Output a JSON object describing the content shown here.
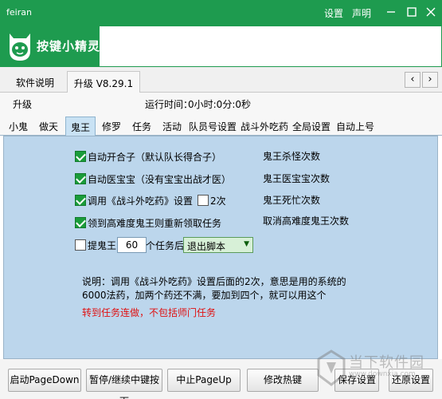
{
  "window": {
    "title": "feiran",
    "menu_settings": "设置",
    "menu_statement": "声明"
  },
  "brand": {
    "logo_text": "按键小精灵"
  },
  "top_tabs": [
    {
      "label": "软件说明"
    },
    {
      "label": "升级 V8.29.1"
    }
  ],
  "info": {
    "page_label": "升级",
    "runtime_label": "运行时间：",
    "runtime_value": "0小时:0分:0秒"
  },
  "script_tabs": [
    {
      "label": "小鬼"
    },
    {
      "label": "做天"
    },
    {
      "label": "鬼王"
    },
    {
      "label": "修罗"
    },
    {
      "label": "任务"
    },
    {
      "label": "活动"
    },
    {
      "label": "队员号设置"
    },
    {
      "label": "战斗外吃药"
    },
    {
      "label": "全局设置"
    },
    {
      "label": "自动上号"
    }
  ],
  "options": {
    "auto_combine": "自动开合子（默认队长得合子）",
    "auto_heal": "自动医宝宝（没有宝宝出战才医）",
    "use_medicine_pre": "调用《战斗外吃药》设置",
    "use_medicine_times": "2次",
    "hard_mode": "领到高难度鬼王则重新领取任务",
    "ghost_king_label": "提鬼王",
    "ghost_king_count": "60",
    "after_tasks_label": "个任务后",
    "after_tasks_action": "退出脚本"
  },
  "stats": {
    "kill": "鬼王杀怪次数",
    "heal": "鬼王医宝宝次数",
    "death": "鬼王死忙次数",
    "cancel": "取消高难度鬼王次数"
  },
  "note": {
    "text": "说明：调用《战斗外吃药》设置后面的2次，意思是用的系统的6000法药，加两个药还不满，要加到四个，就可以用这个",
    "red": "转到任务连做，不包括师门任务"
  },
  "buttons": {
    "start": "启动PageDown",
    "pause": "暂停/继续中键按下",
    "stop": "中止PageUp",
    "hotkey": "修改热键",
    "save": "保存设置",
    "restore": "还原设置"
  },
  "watermark": {
    "text": "当下软件园",
    "sub": "www.downxia.com"
  },
  "colors": {
    "titlebar": "#1e9b4f",
    "panel": "#bcd6ec",
    "checkbox": "#1a9c3a",
    "note_red": "#e01010"
  }
}
